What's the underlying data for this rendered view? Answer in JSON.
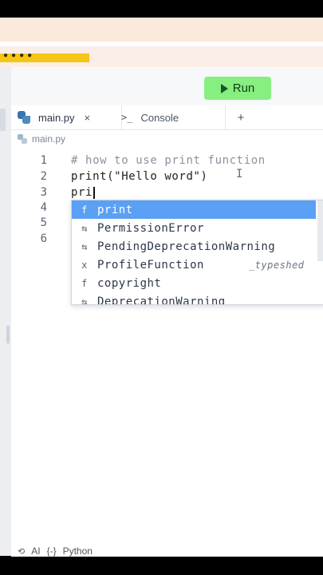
{
  "toolbar": {
    "run_label": "Run"
  },
  "tabs": [
    {
      "label": "main.py",
      "close": "×"
    },
    {
      "label": "Console",
      "icon_text": ">_"
    },
    {
      "label": "+"
    }
  ],
  "breadcrumb": {
    "file": "main.py"
  },
  "editor": {
    "lines": [
      {
        "number": "1",
        "text": "# how to use print function"
      },
      {
        "number": "2",
        "text": "print(\"Hello word\")"
      },
      {
        "number": "3",
        "text": "pri"
      },
      {
        "number": "4",
        "text": ""
      },
      {
        "number": "5",
        "text": ""
      },
      {
        "number": "6",
        "text": ""
      }
    ]
  },
  "autocomplete": {
    "items": [
      {
        "kind": "f",
        "label": "print",
        "detail": "",
        "selected": true
      },
      {
        "kind": "⇆",
        "label": "PermissionError",
        "detail": ""
      },
      {
        "kind": "⇆",
        "label": "PendingDeprecationWarning",
        "detail": ""
      },
      {
        "kind": "x",
        "label": "ProfileFunction",
        "detail": "_typeshed"
      },
      {
        "kind": "f",
        "label": "copyright",
        "detail": ""
      },
      {
        "kind": "⇆",
        "label": "DeprecationWarning",
        "detail": ""
      }
    ]
  },
  "statusbar": {
    "ai_label": "AI",
    "lang_icon": "{-}",
    "language": "Python"
  },
  "colors": {
    "run_button": "#86ef7f",
    "selection": "#5aa0f5",
    "python_blue": "#3776ab"
  }
}
